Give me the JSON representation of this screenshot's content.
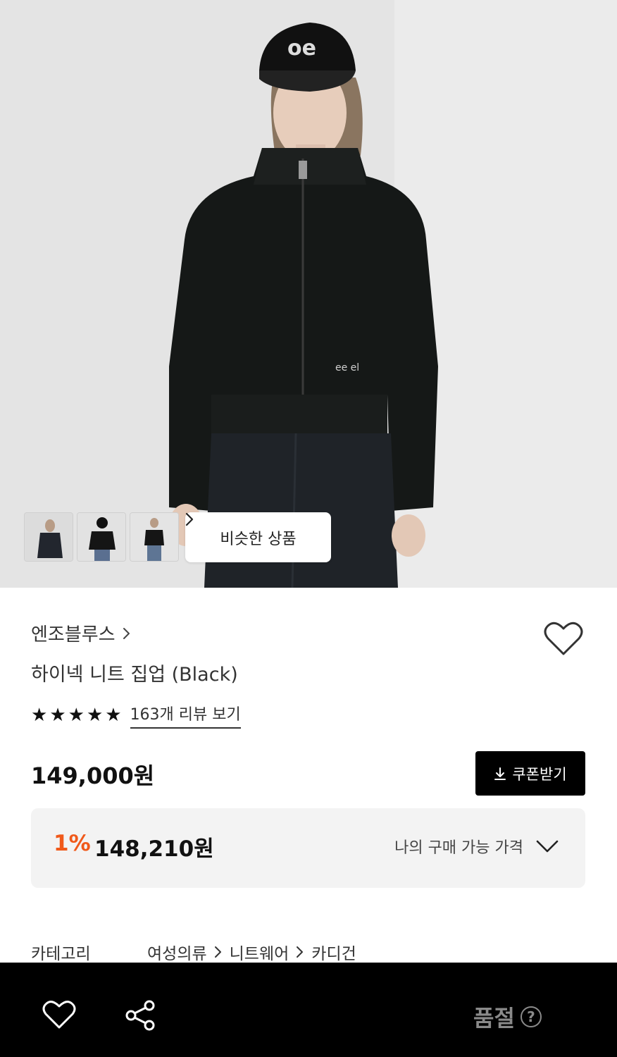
{
  "product": {
    "brand": "엔조블루스",
    "brand_chevron": "›",
    "title": "하이넥 니트 집업 (Black)",
    "rating_stars": 5,
    "review_link": "163개 리뷰 보기",
    "price": "149,000원",
    "coupon_button": "쿠폰받기",
    "discount_rate": "1%",
    "final_price": "148,210원",
    "my_price_label": "나의 구매 가능 가격"
  },
  "gallery": {
    "similar_button": "비슷한 상품",
    "thumbnail_count": 3
  },
  "category": {
    "label": "카테고리",
    "path": [
      "여성의류",
      "니트웨어",
      "카디건"
    ]
  },
  "bottom_bar": {
    "status": "품절",
    "help_symbol": "?"
  },
  "colors": {
    "accent_discount": "#f0591a",
    "coupon_bg": "#000000",
    "bottom_bar_bg": "#000000",
    "soldout_text": "#8a8a8a"
  }
}
